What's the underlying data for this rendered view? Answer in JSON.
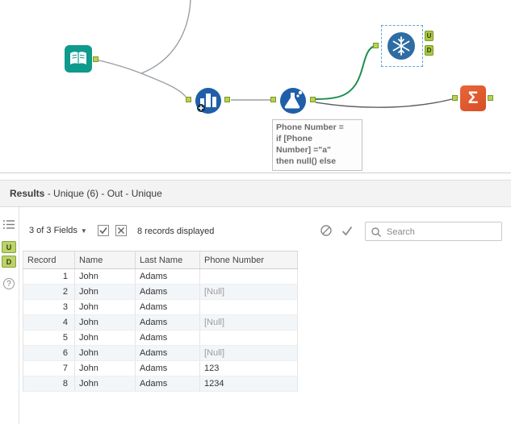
{
  "canvas": {
    "anchors": {
      "u": "U",
      "d": "D"
    },
    "annotation": {
      "lines": [
        "Phone Number =",
        "if [Phone",
        "Number] =\"a\"",
        "then null() else"
      ]
    },
    "sigma_glyph": "Σ"
  },
  "results": {
    "header": {
      "title": "Results",
      "context": " - Unique (6) - Out - Unique"
    },
    "sidebar": {
      "u": "U",
      "d": "D",
      "help": "?"
    },
    "toolbar": {
      "fields": "3 of 3 Fields",
      "records": "8 records displayed",
      "search_placeholder": "Search"
    },
    "table": {
      "columns": [
        "Record",
        "Name",
        "Last Name",
        "Phone Number"
      ],
      "rows": [
        [
          "1",
          "John",
          "Adams",
          ""
        ],
        [
          "2",
          "John",
          "Adams",
          "[Null]"
        ],
        [
          "3",
          "John",
          "Adams",
          ""
        ],
        [
          "4",
          "John",
          "Adams",
          "[Null]"
        ],
        [
          "5",
          "John",
          "Adams",
          ""
        ],
        [
          "6",
          "John",
          "Adams",
          "[Null]"
        ],
        [
          "7",
          "John",
          "Adams",
          "123"
        ],
        [
          "8",
          "John",
          "Adams",
          "1234"
        ]
      ]
    }
  }
}
